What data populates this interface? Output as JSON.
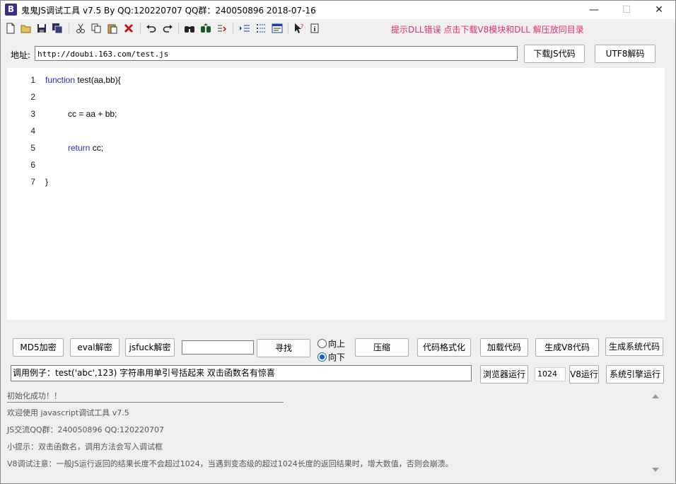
{
  "window": {
    "title": "鬼鬼JS调试工具 v7.5 By QQ:120220707  QQ群：240050896  2018-07-16",
    "app_icon_letter": "B",
    "minimize": "—",
    "maximize": "☐",
    "close": "✕"
  },
  "toolbar": {
    "icons": [
      "new-file-icon",
      "open-folder-icon",
      "save-icon",
      "save-all-icon",
      "cut-icon",
      "copy-icon",
      "paste-icon",
      "delete-icon",
      "undo-icon",
      "redo-icon",
      "find-icon",
      "find-next-icon",
      "replace-icon",
      "indent-icon",
      "list-icon",
      "window-icon",
      "help-cursor-icon",
      "info-icon"
    ],
    "hint": "提示DLL错误 点击下载V8模块和DLL 解压放同目录"
  },
  "address": {
    "label": "地址:",
    "value": "http://doubi.163.com/test.js",
    "download_button": "下载JS代码",
    "utf8_button": "UTF8解码"
  },
  "editor": {
    "line_numbers": [
      "1",
      "2",
      "3",
      "4",
      "5",
      "6",
      "7"
    ],
    "lines": [
      {
        "kw": "function",
        "text": " test(aa,bb){"
      },
      {
        "kw": "",
        "text": ""
      },
      {
        "kw": "",
        "text": "cc = aa + bb;"
      },
      {
        "kw": "",
        "text": ""
      },
      {
        "kw": "return",
        "text": " cc;"
      },
      {
        "kw": "",
        "text": ""
      },
      {
        "kw": "",
        "text": "}"
      }
    ]
  },
  "actions": {
    "md5": "MD5加密",
    "eval_decode": "eval解密",
    "jsfuck_decode": "jsfuck解密",
    "search_value": "",
    "find": "寻找",
    "radio_up": "向上",
    "radio_down": "向下",
    "radio_selected": "向下",
    "compress": "压缩",
    "format": "代码格式化",
    "load_code": "加载代码",
    "gen_v8": "生成V8代码",
    "gen_sys": "生成系统代码",
    "call_example": "调用例子：test('abc',123) 字符串用单引号括起来 双击函数名有惊喜",
    "browser_run": "浏览器运行",
    "length_value": "1024",
    "v8_run": "V8运行",
    "sys_engine_run": "系统引擎运行"
  },
  "output": {
    "lines": [
      "初始化成功！！",
      "欢迎使用 javascript调试工具 v7.5",
      "JS交流QQ群：240050896  QQ:120220707",
      "小提示：双击函数名，调用方法会写入调试框",
      "V8调试注意：一般JS运行返回的结果长度不会超过1024，当遇到变态级的超过1024长度的返回结果时，增大数值，否则会崩溃。"
    ]
  }
}
